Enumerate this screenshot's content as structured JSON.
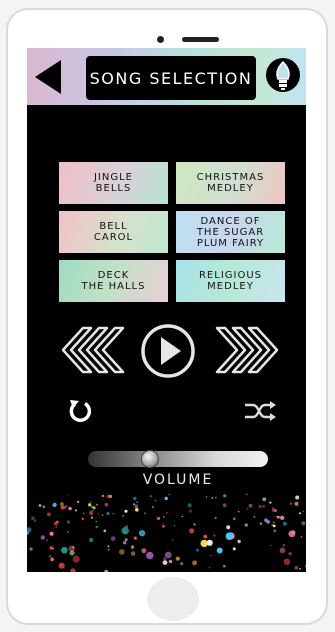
{
  "header": {
    "title": "SONG SELECTION",
    "back_icon": "back-arrow-icon",
    "settings_icon": "lightbulb-icon"
  },
  "songs": [
    {
      "label": "JINGLE\nBELLS"
    },
    {
      "label": "CHRISTMAS\nMEDLEY"
    },
    {
      "label": "BELL\nCAROL"
    },
    {
      "label": "DANCE OF\nTHE SUGAR\nPLUM FAIRY"
    },
    {
      "label": "DECK\nTHE HALLS"
    },
    {
      "label": "RELIGIOUS\nMEDLEY"
    }
  ],
  "controls": {
    "rewind_icon": "rewind-icon",
    "play_icon": "play-icon",
    "fast_forward_icon": "fast-forward-icon",
    "repeat_icon": "repeat-icon",
    "shuffle_icon": "shuffle-icon"
  },
  "volume": {
    "label": "VOLUME",
    "level": 0.33
  },
  "colors": {
    "screen_background": "#000000",
    "header_gradient_start": "#d8b8cf",
    "header_gradient_end": "#bfe5f1",
    "control_stroke": "#e6e6e6"
  }
}
